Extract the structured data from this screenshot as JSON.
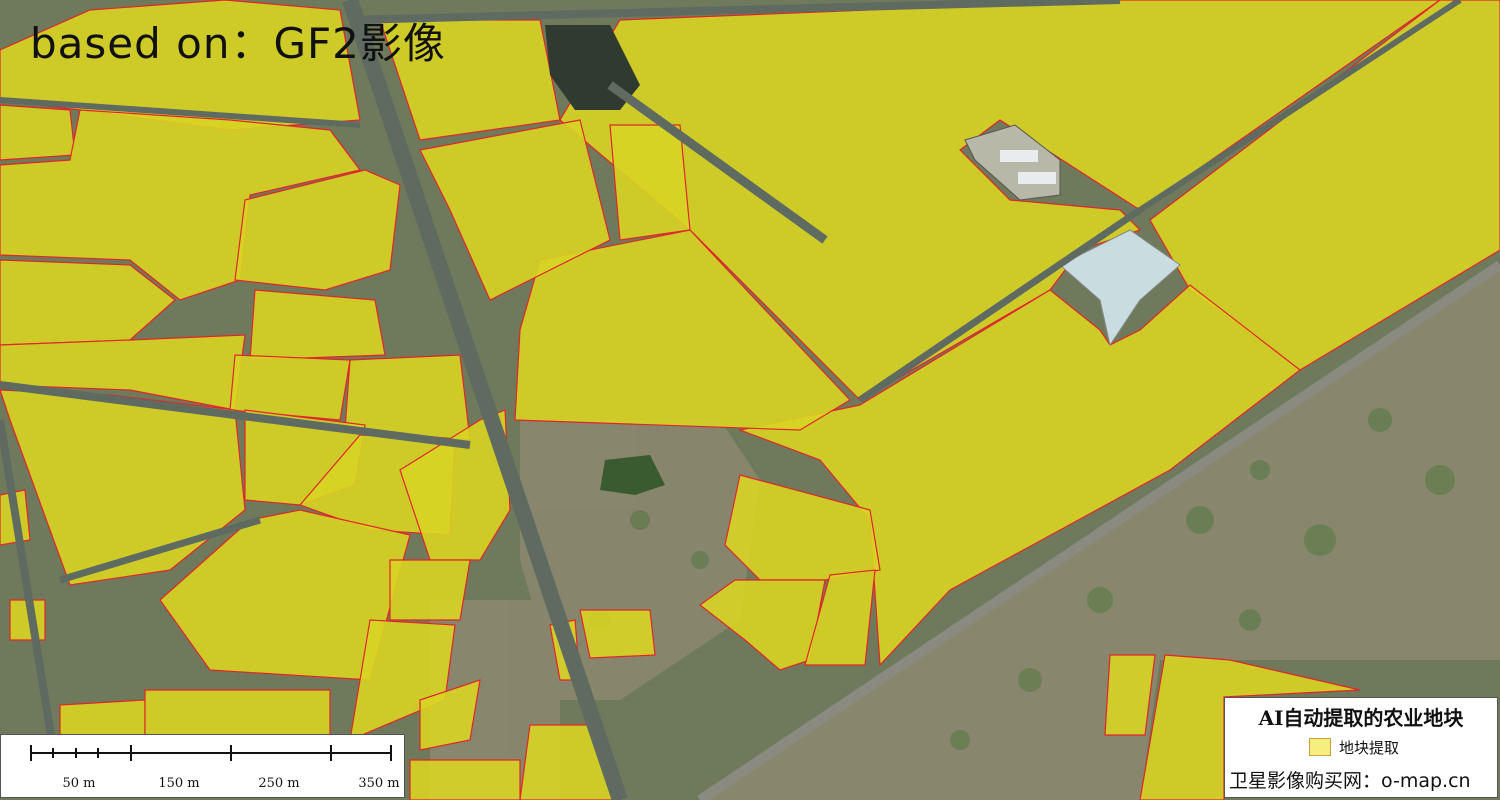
{
  "overlay": {
    "title": "based on：GF2影像"
  },
  "legend": {
    "title": "AI自动提取的农业地块",
    "item_label": "地块提取",
    "swatch_fill": "#f7ee80",
    "swatch_border": "#c9a13a",
    "footer": "卫星影像购买网：o-map.cn"
  },
  "scalebar": {
    "ticks": [
      "50 m",
      "150 m",
      "250 m",
      "350 m"
    ]
  },
  "colors": {
    "field_fill": "#d8d424",
    "field_outline": "#e0262a",
    "road": "#5f6a60",
    "background": "#6f7a5c"
  }
}
